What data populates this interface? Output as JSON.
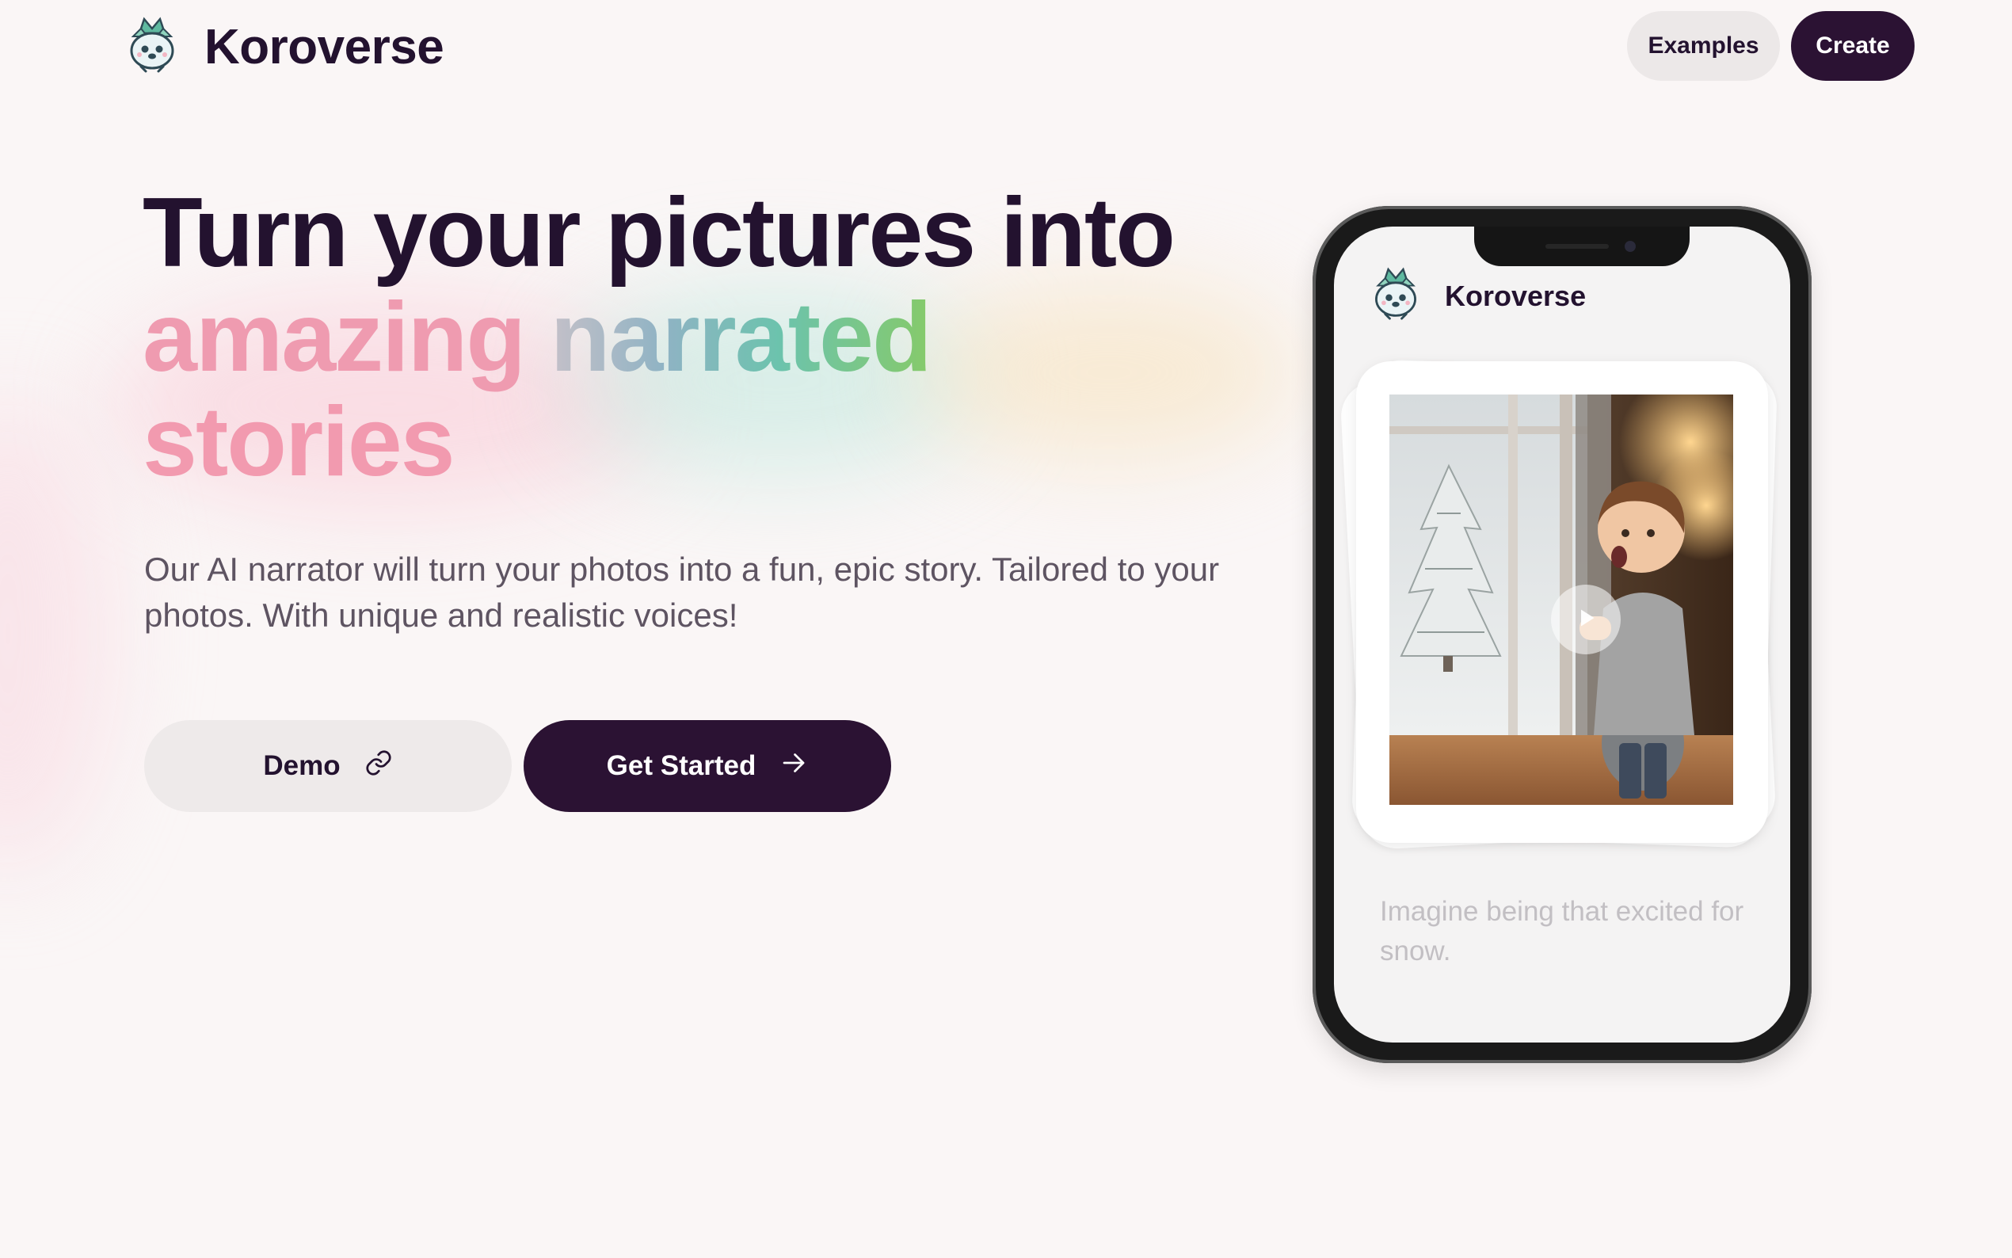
{
  "header": {
    "brand_name": "Koroverse",
    "logo_icon": "koroverse-mascot-icon",
    "nav": {
      "examples_label": "Examples",
      "create_label": "Create"
    }
  },
  "hero": {
    "headline_line1": "Turn your pictures into",
    "headline_word_amazing": "amazing",
    "headline_word_narrated": "narrated",
    "headline_line3": "stories",
    "subtitle": "Our AI narrator will turn your photos into a fun, epic story. Tailored to your photos. With unique and realistic voices!",
    "demo_label": "Demo",
    "demo_icon": "link-icon",
    "get_started_label": "Get Started",
    "get_started_icon": "arrow-right-icon"
  },
  "phone": {
    "brand_name": "Koroverse",
    "story_image_icon": "play-icon",
    "caption": "Imagine being that excited for snow."
  },
  "colors": {
    "dark": "#23122f",
    "button_dark": "#2b1233",
    "button_light": "#ece8e8",
    "pink": "#ef9bb0",
    "green": "#86ca6a",
    "background": "#faf6f6"
  }
}
